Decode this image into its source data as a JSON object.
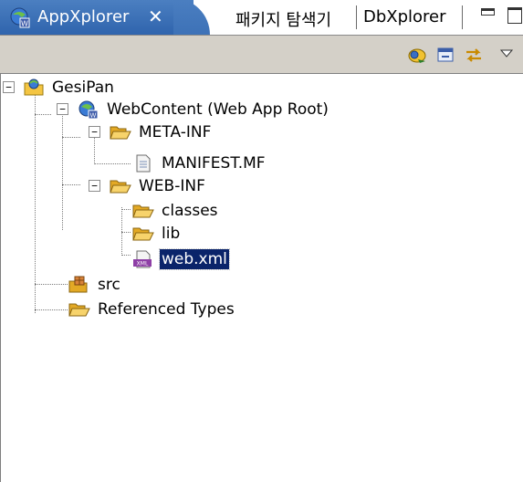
{
  "tabs": [
    {
      "label": "AppXplorer",
      "close": "✕",
      "active": true
    },
    {
      "label": "패키지 탐색기",
      "active": false
    },
    {
      "label": "DbXplorer",
      "active": false
    }
  ],
  "toolbar": {
    "buttons": [
      "link-editor-icon",
      "collapse-all-icon",
      "sync-icon",
      "view-menu-icon"
    ]
  },
  "tree": {
    "items": [
      {
        "label": "GesiPan",
        "icon": "project-icon",
        "twisty": "−"
      },
      {
        "label": "WebContent (Web App Root)",
        "icon": "web-root-icon",
        "twisty": "−"
      },
      {
        "label": "META-INF",
        "icon": "folder-icon",
        "twisty": "−"
      },
      {
        "label": "MANIFEST.MF",
        "icon": "file-icon"
      },
      {
        "label": "WEB-INF",
        "icon": "folder-icon",
        "twisty": "−"
      },
      {
        "label": "classes",
        "icon": "folder-icon"
      },
      {
        "label": "lib",
        "icon": "folder-icon"
      },
      {
        "label": "web.xml",
        "icon": "xml-file-icon",
        "selected": true
      },
      {
        "label": "src",
        "icon": "source-folder-icon"
      },
      {
        "label": "Referenced Types",
        "icon": "folder-icon"
      }
    ]
  },
  "colors": {
    "active_tab": "#2f64ad",
    "toolbar_bg": "#d4d0c8",
    "selection": "#0a246a",
    "folder": "#f4c542"
  }
}
